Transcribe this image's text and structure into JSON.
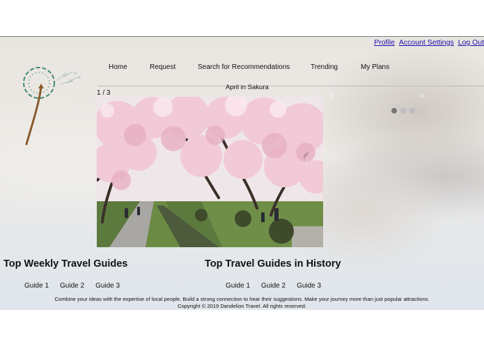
{
  "account_links": {
    "profile": "Profile",
    "account_settings": "Account Settings",
    "log_out": "Log Out"
  },
  "nav": {
    "items": [
      "Home",
      "Request",
      "Search for Recommendations",
      "Trending",
      "My Plans"
    ]
  },
  "slideshow": {
    "counter": "1 / 3",
    "caption": "April in Sakura",
    "prev_arrow": "‹",
    "next_arrow": "›",
    "active_dot": 1,
    "dot_count": 3,
    "image_subject": "cherry-blossom-path"
  },
  "sections": {
    "weekly": {
      "title": "Top Weekly Travel Guides",
      "guides": [
        "Guide 1",
        "Guide 2",
        "Guide 3"
      ]
    },
    "history": {
      "title": "Top Travel Guides in History",
      "guides": [
        "Guide 1",
        "Guide 2",
        "Guide 3"
      ]
    }
  },
  "footer": {
    "tagline": "Combine your ideas with the expertise of local people. Build a strong connection to hear their suggestions. Make your journey more than just popular attractions.",
    "copyright": "Copyright © 2019 Dandelion Travel. All rights reserved."
  },
  "colors": {
    "link": "#1a0dab",
    "logo_stem": "#8a5a2b",
    "logo_ring": "#3f8a72",
    "blossom": "#f2c9d6"
  }
}
